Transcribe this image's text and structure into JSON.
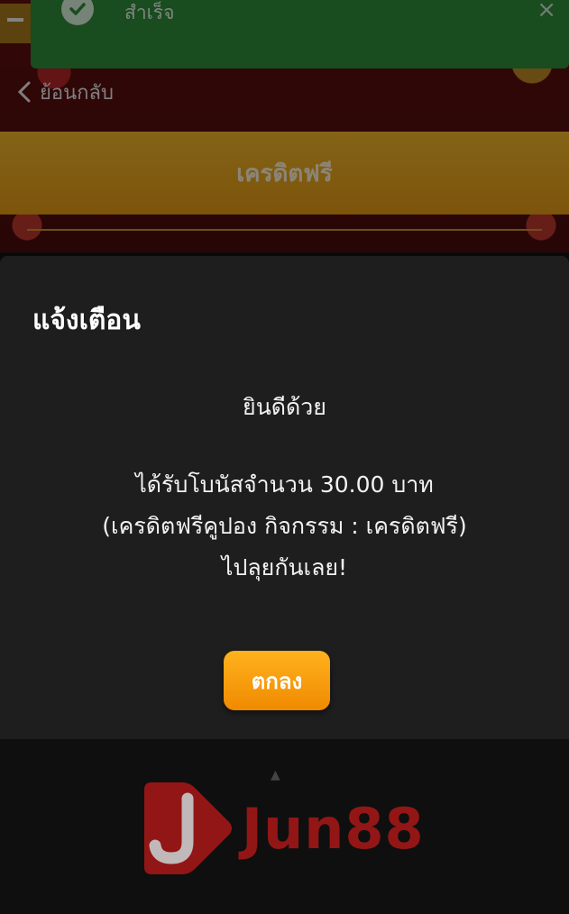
{
  "toast": {
    "message": "สำเร็จ",
    "close_glyph": "×",
    "color": "#2e8b3a"
  },
  "background": {
    "back_label": "ย้อนกลับ",
    "credit_bar_label": "เครดิตฟรี"
  },
  "dialog": {
    "title": "แจ้งเตือน",
    "greeting": "ยินดีด้วย",
    "line1": "ได้รับโบนัสจำนวน 30.00 บาท",
    "line2": "(เครดิตฟรีคูปอง กิจกรรม : เครดิตฟรี)",
    "line3": "ไปลุยกันเลย!",
    "ok_label": "ตกลง",
    "ok_color": "#f59a0a"
  },
  "watermark": {
    "text": "Jun88",
    "color": "#b81818"
  }
}
